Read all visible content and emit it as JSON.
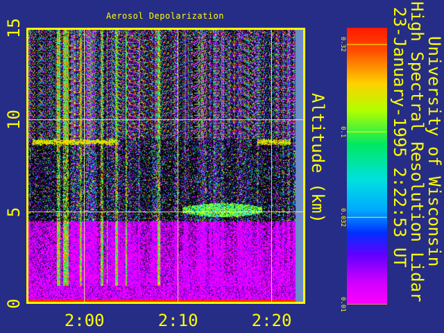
{
  "chart_data": {
    "type": "heatmap",
    "title": "Aerosol Depolarization",
    "ylabel": "Altitude (km)",
    "ylim": [
      0,
      15
    ],
    "y_ticks": [
      "0",
      "5",
      "10",
      "15"
    ],
    "x_ticks": [
      "2:00",
      "2:10",
      "2:20"
    ],
    "x_tick_values_min": [
      120,
      130,
      140
    ],
    "xlim_min": [
      113.8,
      143.6
    ],
    "colorbar": {
      "scale": "log",
      "range": [
        0.01,
        0.4
      ],
      "ticks": [
        "0.01",
        "0.032",
        "0.1",
        "0.32"
      ],
      "tick_values": [
        0.01,
        0.032,
        0.1,
        0.32
      ]
    },
    "grid": true,
    "features": [
      {
        "kind": "cloud layer",
        "x_min": [
          130.5,
          139
        ],
        "altitude_km": 5.1
      },
      {
        "kind": "cirrus layer",
        "x_min": [
          114.5,
          123.5
        ],
        "altitude_km": 8.8
      },
      {
        "kind": "cirrus layer",
        "x_min": [
          138.5,
          142
        ],
        "altitude_km": 8.8
      }
    ]
  },
  "header": {
    "line1": "University of Wisconsin",
    "line2": "High Spectral Resolution Lidar",
    "line3": "23-January-1995   2:22:53 UT"
  },
  "colors": {
    "background": "#262d86",
    "axis": "#ffff00",
    "grid": "#ffff80",
    "nodata": "#6c8cc8"
  }
}
